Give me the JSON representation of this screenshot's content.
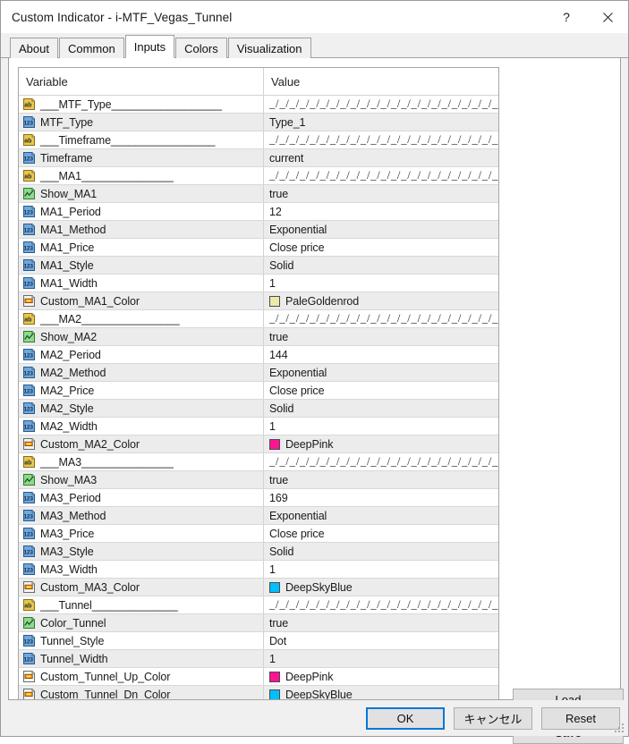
{
  "window": {
    "title": "Custom Indicator - i-MTF_Vegas_Tunnel",
    "help_label": "?",
    "close_label": "×"
  },
  "tabs": [
    {
      "label": "About",
      "active": false
    },
    {
      "label": "Common",
      "active": false
    },
    {
      "label": "Inputs",
      "active": true
    },
    {
      "label": "Colors",
      "active": false
    },
    {
      "label": "Visualization",
      "active": false
    }
  ],
  "grid": {
    "headers": {
      "variable": "Variable",
      "value": "Value"
    },
    "separator_value": "_/_/_/_/_/_/_/_/_/_/_/_/_/_/_/_/_/_/_/_/_/_/_/_/_/...",
    "rows": [
      {
        "icon": "string-icon",
        "name": "___MTF_Type__________________",
        "value": "__SEPARATOR__"
      },
      {
        "icon": "number-icon",
        "name": "MTF_Type",
        "value": "Type_1"
      },
      {
        "icon": "string-icon",
        "name": "___Timeframe_________________",
        "value": "__SEPARATOR__"
      },
      {
        "icon": "number-icon",
        "name": "Timeframe",
        "value": "current"
      },
      {
        "icon": "string-icon",
        "name": "___MA1_______________",
        "value": "__SEPARATOR__"
      },
      {
        "icon": "bool-icon",
        "name": "Show_MA1",
        "value": "true"
      },
      {
        "icon": "number-icon",
        "name": "MA1_Period",
        "value": "12"
      },
      {
        "icon": "number-icon",
        "name": "MA1_Method",
        "value": "Exponential"
      },
      {
        "icon": "number-icon",
        "name": "MA1_Price",
        "value": "Close price"
      },
      {
        "icon": "number-icon",
        "name": "MA1_Style",
        "value": "Solid"
      },
      {
        "icon": "number-icon",
        "name": "MA1_Width",
        "value": "1"
      },
      {
        "icon": "color-icon",
        "name": "Custom_MA1_Color",
        "value": "PaleGoldenrod",
        "swatch": "#EEE8AA"
      },
      {
        "icon": "string-icon",
        "name": "___MA2________________",
        "value": "__SEPARATOR__"
      },
      {
        "icon": "bool-icon",
        "name": "Show_MA2",
        "value": "true"
      },
      {
        "icon": "number-icon",
        "name": "MA2_Period",
        "value": "144"
      },
      {
        "icon": "number-icon",
        "name": "MA2_Method",
        "value": "Exponential"
      },
      {
        "icon": "number-icon",
        "name": "MA2_Price",
        "value": "Close price"
      },
      {
        "icon": "number-icon",
        "name": "MA2_Style",
        "value": "Solid"
      },
      {
        "icon": "number-icon",
        "name": "MA2_Width",
        "value": "1"
      },
      {
        "icon": "color-icon",
        "name": "Custom_MA2_Color",
        "value": "DeepPink",
        "swatch": "#FF1493"
      },
      {
        "icon": "string-icon",
        "name": "___MA3_______________",
        "value": "__SEPARATOR__"
      },
      {
        "icon": "bool-icon",
        "name": "Show_MA3",
        "value": "true"
      },
      {
        "icon": "number-icon",
        "name": "MA3_Period",
        "value": "169"
      },
      {
        "icon": "number-icon",
        "name": "MA3_Method",
        "value": "Exponential"
      },
      {
        "icon": "number-icon",
        "name": "MA3_Price",
        "value": "Close price"
      },
      {
        "icon": "number-icon",
        "name": "MA3_Style",
        "value": "Solid"
      },
      {
        "icon": "number-icon",
        "name": "MA3_Width",
        "value": "1"
      },
      {
        "icon": "color-icon",
        "name": "Custom_MA3_Color",
        "value": "DeepSkyBlue",
        "swatch": "#00BFFF"
      },
      {
        "icon": "string-icon",
        "name": "___Tunnel______________",
        "value": "__SEPARATOR__"
      },
      {
        "icon": "bool-icon",
        "name": "Color_Tunnel",
        "value": "true"
      },
      {
        "icon": "number-icon",
        "name": "Tunnel_Style",
        "value": "Dot"
      },
      {
        "icon": "number-icon",
        "name": "Tunnel_Width",
        "value": "1"
      },
      {
        "icon": "color-icon",
        "name": "Custom_Tunnel_Up_Color",
        "value": "DeepPink",
        "swatch": "#FF1493"
      },
      {
        "icon": "color-icon",
        "name": "Custom_Tunnel_Dn_Color",
        "value": "DeepSkyBlue",
        "swatch": "#00BFFF"
      }
    ]
  },
  "side_buttons": {
    "load": "Load",
    "save": "Save"
  },
  "bottom_buttons": {
    "ok": "OK",
    "cancel": "キャンセル",
    "reset": "Reset"
  },
  "colors": {
    "accent": "#0078D7",
    "row_alt": "#ECECEC",
    "dialog_bg": "#F0F0F0"
  }
}
